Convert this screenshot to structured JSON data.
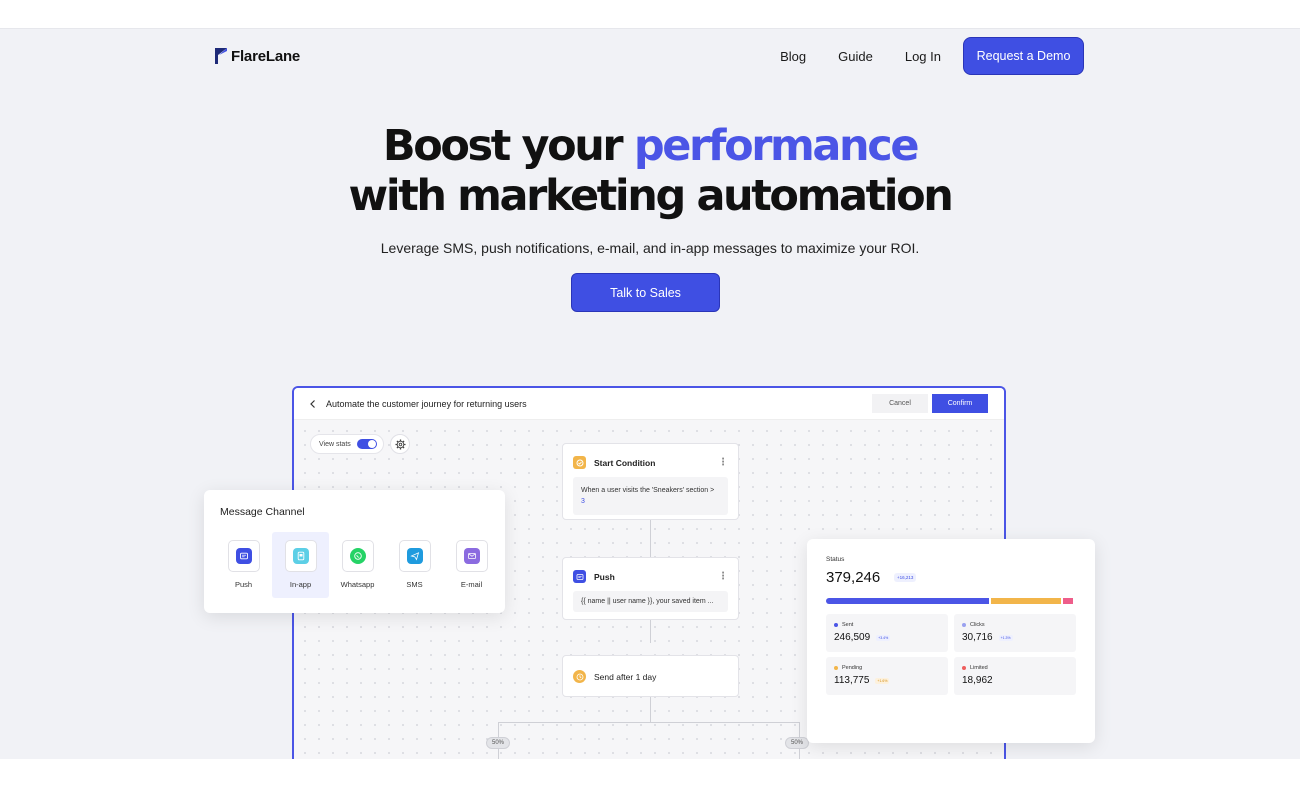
{
  "nav": {
    "logo": "FlareLane",
    "links": [
      "Blog",
      "Guide",
      "Log In"
    ],
    "cta": "Request a Demo"
  },
  "hero": {
    "title_part1": "Boost your ",
    "title_accent": "performance",
    "title_line2": "with marketing automation",
    "subtitle": "Leverage SMS, push notifications, e-mail, and in-app messages to maximize your ROI.",
    "cta": "Talk to Sales"
  },
  "app": {
    "title": "Automate the customer journey for returning users",
    "cancel": "Cancel",
    "confirm": "Confirm",
    "view_stats": "View stats",
    "nodes": {
      "start": {
        "title": "Start Condition",
        "body_text": "When a user visits the 'Sneakers' section >",
        "body_link": "3"
      },
      "push": {
        "title": "Push",
        "body_text": "{{ name || user name }}, your saved item ..."
      },
      "delay": {
        "title": "Send after 1 day"
      }
    },
    "split_left": "50%",
    "split_right": "50%"
  },
  "channel_card": {
    "title": "Message Channel",
    "channels": [
      {
        "label": "Push",
        "icon": "push-icon",
        "color": "#3f4fe3"
      },
      {
        "label": "In-app",
        "icon": "in-app-icon",
        "color": "#5ccfe6"
      },
      {
        "label": "Whatsapp",
        "icon": "whatsapp-icon",
        "color": "#25d366"
      },
      {
        "label": "SMS",
        "icon": "sms-icon",
        "color": "#1f9bde"
      },
      {
        "label": "E-mail",
        "icon": "email-icon",
        "color": "#8b6be0"
      }
    ],
    "active": "In-app"
  },
  "status_card": {
    "label": "Status",
    "total": "379,246",
    "delta": "+16,213",
    "bar": [
      {
        "name": "Sent",
        "fraction": 0.65,
        "color": "#4b55e6"
      },
      {
        "name": "Pending",
        "fraction": 0.28,
        "color": "#f2b54a"
      },
      {
        "name": "Limited",
        "fraction": 0.04,
        "color": "#ee5d8a"
      }
    ],
    "stats": [
      {
        "name": "Sent",
        "value": "246,509",
        "delta": "+3.4%",
        "color": "#4b55e6",
        "delta_color": "#3f4fe3",
        "delta_bg": "#eef0fe"
      },
      {
        "name": "Clicks",
        "value": "30,716",
        "delta": "+1.3%",
        "color": "#9aa1f0",
        "delta_color": "#3f4fe3",
        "delta_bg": "#eef0fe"
      },
      {
        "name": "Pending",
        "value": "113,775",
        "delta": "+1.6%",
        "color": "#f2b54a",
        "delta_color": "#d48d10",
        "delta_bg": "#fdf1dd"
      },
      {
        "name": "Limited",
        "value": "18,962",
        "delta": "",
        "color": "#ee5d5d",
        "delta_color": "#d33",
        "delta_bg": "#fde6e6"
      }
    ]
  },
  "colors": {
    "accent": "#3f4fe3",
    "page_bg": "#f1f2f6"
  }
}
